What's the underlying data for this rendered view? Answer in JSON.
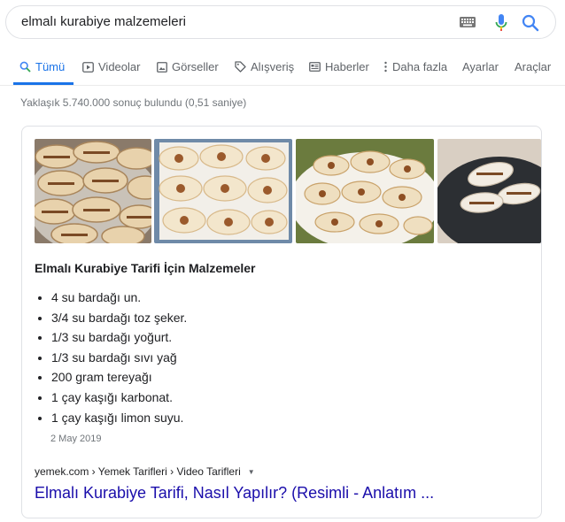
{
  "search": {
    "query": "elmalı kurabiye malzemeleri",
    "icons": [
      "keyboard-icon",
      "mic-icon",
      "search-icon"
    ]
  },
  "tabs": [
    {
      "label": "Tümü",
      "icon": "search-icon",
      "active": true
    },
    {
      "label": "Videolar",
      "icon": "video-icon"
    },
    {
      "label": "Görseller",
      "icon": "image-icon"
    },
    {
      "label": "Alışveriş",
      "icon": "tag-icon"
    },
    {
      "label": "Haberler",
      "icon": "news-icon"
    },
    {
      "label": "Daha fazla",
      "icon": "more-vert-icon"
    },
    {
      "label": "Ayarlar"
    },
    {
      "label": "Araçlar"
    }
  ],
  "stats": "Yaklaşık 5.740.000 sonuç bulundu (0,51 saniye)",
  "snippet": {
    "heading": "Elmalı Kurabiye Tarifi İçin Malzemeler",
    "ingredients": [
      "4 su bardağı un.",
      "3/4 su bardağı toz şeker.",
      "1/3 su bardağı yoğurt.",
      "1/3 su bardağı sıvı yağ",
      "200 gram tereyağı",
      "1 çay kaşığı karbonat.",
      "1 çay kaşığı limon suyu."
    ],
    "date": "2 May 2019",
    "breadcrumb": "yemek.com › Yemek Tarifleri › Video Tarifleri",
    "title": "Elmalı Kurabiye Tarifi, Nasıl Yapılır? (Resimli - Anlatım ..."
  },
  "colors": {
    "link": "#1a0dab",
    "accent": "#1a73e8",
    "muted": "#70757a"
  }
}
